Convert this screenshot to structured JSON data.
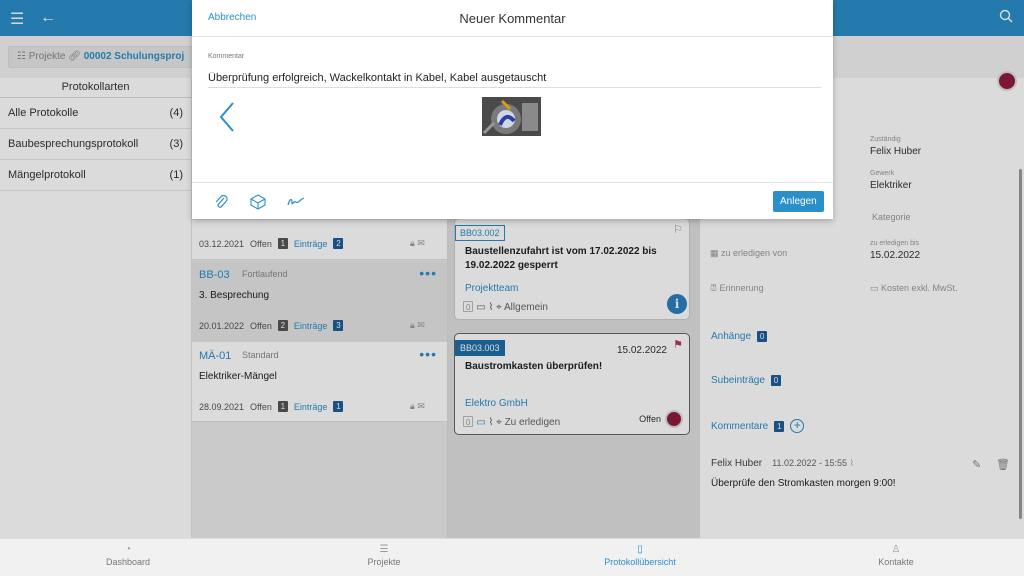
{
  "crumb": {
    "prefix": "Projekte",
    "project": "00002 Schulungsproj"
  },
  "types": {
    "header": "Protokollarten",
    "items": [
      {
        "label": "Alle Protokolle",
        "count": "(4)"
      },
      {
        "label": "Baubesprechungsprotokoll",
        "count": "(3)"
      },
      {
        "label": "Mängelprotokoll",
        "count": "(1)"
      }
    ]
  },
  "protocols": [
    {
      "date": "03.12.2021",
      "open_label": "Offen",
      "open": "1",
      "entries_label": "Einträge",
      "entries": "2"
    },
    {
      "code": "BB-03",
      "kind": "Fortlaufend",
      "title": "3. Besprechung",
      "date": "20.01.2022",
      "open_label": "Offen",
      "open": "2",
      "entries_label": "Einträge",
      "entries": "3"
    },
    {
      "code": "MÄ-01",
      "kind": "Standard",
      "title": "Elektriker-Mängel",
      "date": "28.09.2021",
      "open_label": "Offen",
      "open": "1",
      "entries_label": "Einträge",
      "entries": "1"
    }
  ],
  "entries": [
    {
      "tag": "BB03.002",
      "title": "Baustellenzufahrt ist vom 17.02.2022 bis 19.02.2022 gesperrt",
      "firm": "Projektteam",
      "count": "0",
      "category": "Allgemein"
    },
    {
      "tag": "BB03.003",
      "date": "15.02.2022",
      "title": "Baustromkasten überprüfen!",
      "firm": "Elektro GmbH",
      "count": "0",
      "category": "Zu erledigen",
      "status": "Offen"
    }
  ],
  "detail": {
    "assignee_label": "Zuständig",
    "assignee": "Felix Huber",
    "trade_label": "Gewerk",
    "trade": "Elektriker",
    "category_hint": "Kategorie",
    "due_from_hint": "zu erledigen von",
    "due_until_label": "zu erledigen bis",
    "due_until": "15.02.2022",
    "reminder_hint": "Erinnerung",
    "cost_hint": "Kosten exkl. MwSt.",
    "attachments_label": "Anhänge",
    "attachments": "0",
    "subentries_label": "Subeinträge",
    "subentries": "0",
    "comments_label": "Kommentare",
    "comments": "1",
    "comment_author": "Felix Huber",
    "comment_time": "11.02.2022 - 15:55",
    "comment_text": "Überprüfe den Stromkasten morgen 9:00!"
  },
  "modal": {
    "cancel": "Abbrechen",
    "title": "Neuer Kommentar",
    "field_label": "Kommentar",
    "field_value": "Überprüfung erfolgreich, Wackelkontakt in Kabel, Kabel ausgetauscht",
    "submit": "Anlegen"
  },
  "nav": [
    {
      "label": "Dashboard"
    },
    {
      "label": "Projekte"
    },
    {
      "label": "Protokollübersicht"
    },
    {
      "label": "Kontakte"
    }
  ],
  "colors": {
    "accent": "#2b8fc9",
    "status": "#8e1b3c",
    "badge": "#1e5f9a"
  }
}
